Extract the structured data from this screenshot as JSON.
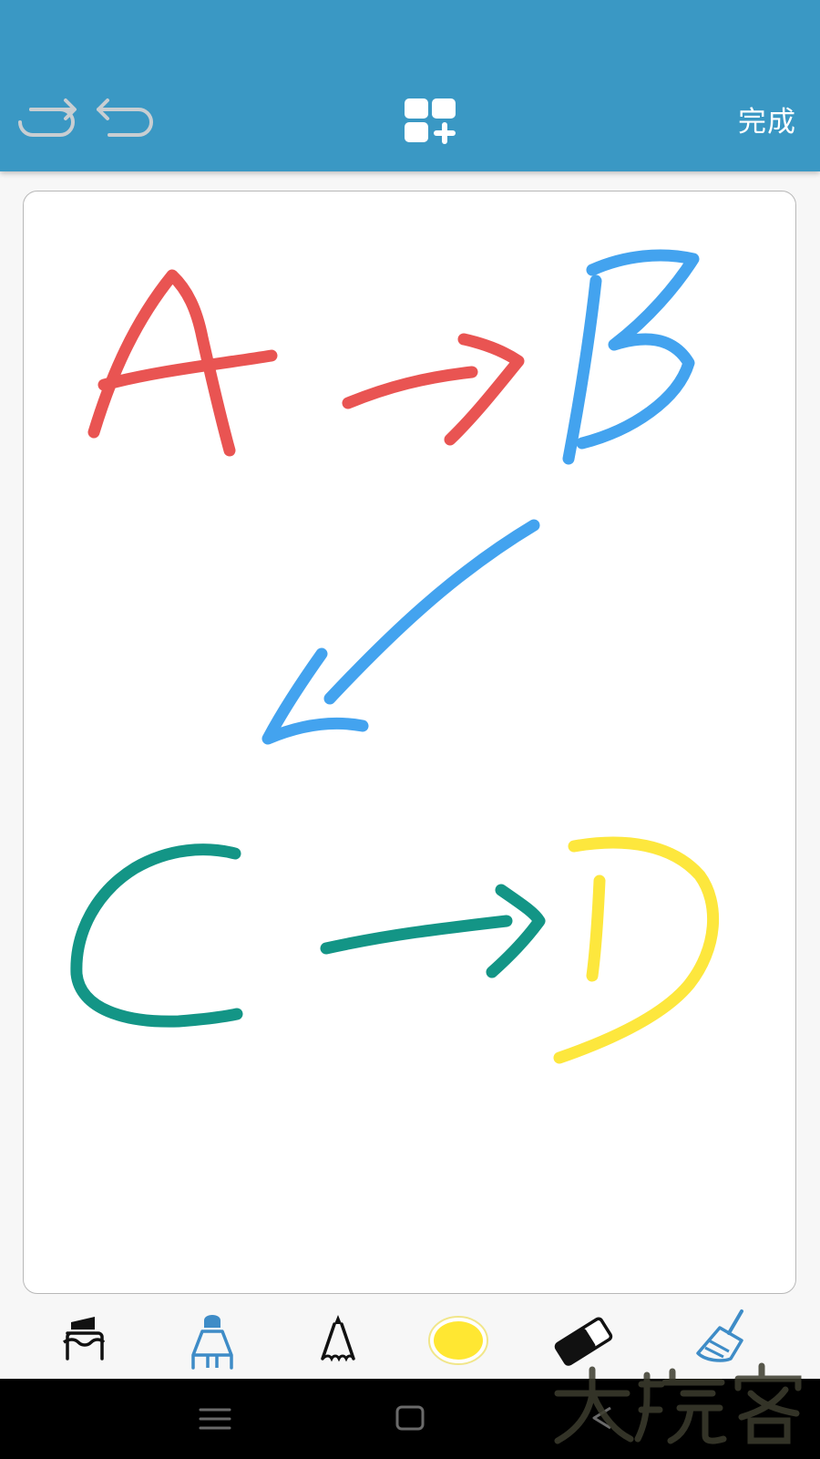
{
  "app": {
    "done_label": "完成"
  },
  "toolbar_top": {
    "redo_icon": "redo-arrow-icon",
    "undo_icon": "undo-arrow-icon",
    "add_page_icon": "add-page-grid-icon"
  },
  "canvas": {
    "strokes": [
      {
        "glyph": "A",
        "color": "#e95452"
      },
      {
        "glyph": "arrow-right",
        "color": "#e95452"
      },
      {
        "glyph": "B",
        "color": "#43a3ef"
      },
      {
        "glyph": "arrow-down-left",
        "color": "#43a3ef"
      },
      {
        "glyph": "C",
        "color": "#139586"
      },
      {
        "glyph": "arrow-right",
        "color": "#139586"
      },
      {
        "glyph": "D",
        "color": "#fde73d"
      }
    ]
  },
  "tools": [
    {
      "name": "marker",
      "icon": "marker-icon",
      "selected": false
    },
    {
      "name": "brush-pen",
      "icon": "brush-pen-icon",
      "selected": true
    },
    {
      "name": "pencil",
      "icon": "pencil-icon",
      "selected": false
    },
    {
      "name": "color",
      "icon": "color-swatch-icon",
      "color": "#ffe732",
      "selected": false
    },
    {
      "name": "eraser",
      "icon": "eraser-icon",
      "selected": false
    },
    {
      "name": "clear",
      "icon": "broom-icon",
      "selected": false
    }
  ],
  "colors": {
    "topbar": "#3a98c4",
    "selected_tool": "#3e8cc7",
    "inactive_icon": "#c8ced2"
  },
  "navbar": {
    "menu_icon": "menu-icon",
    "home_icon": "home-icon",
    "back_icon": "back-icon"
  }
}
